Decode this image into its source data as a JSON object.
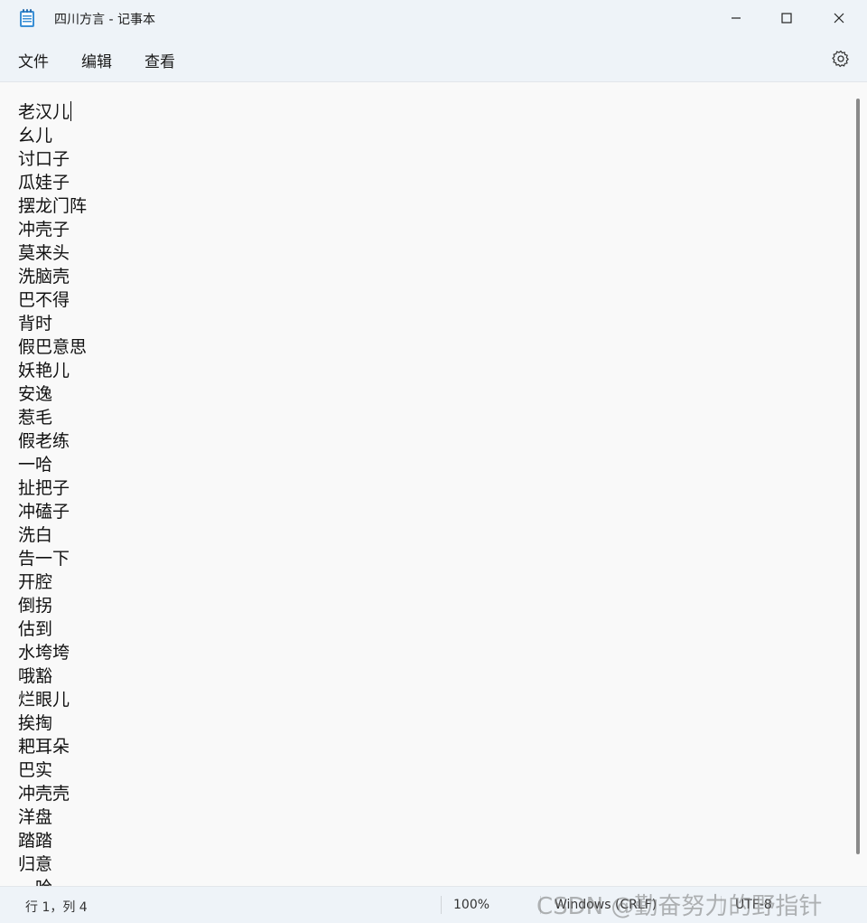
{
  "window": {
    "title": "四川方言 - 记事本"
  },
  "menu": {
    "items": [
      "文件",
      "编辑",
      "查看"
    ]
  },
  "editor": {
    "lines": [
      "老汉儿",
      "幺儿",
      "讨口子",
      "瓜娃子",
      "摆龙门阵",
      "冲壳子",
      "莫来头",
      "洗脑壳",
      "巴不得",
      "背时",
      "假巴意思",
      "妖艳儿",
      "安逸",
      "惹毛",
      "假老练",
      "一哈",
      "扯把子",
      "冲磕子",
      "洗白",
      "告一下",
      "开腔",
      "倒拐",
      "估到",
      "水垮垮",
      "哦豁",
      "烂眼儿",
      "挨掏",
      "耙耳朵",
      "巴实",
      "冲壳壳",
      "洋盘",
      "踏踏",
      "归意",
      "一哈"
    ]
  },
  "status": {
    "position": "行 1，列 4",
    "zoom": "100%",
    "line_ending": "Windows (CRLF)",
    "encoding": "UTF-8"
  },
  "watermark": "CSDN @勤奋努力的野指针"
}
